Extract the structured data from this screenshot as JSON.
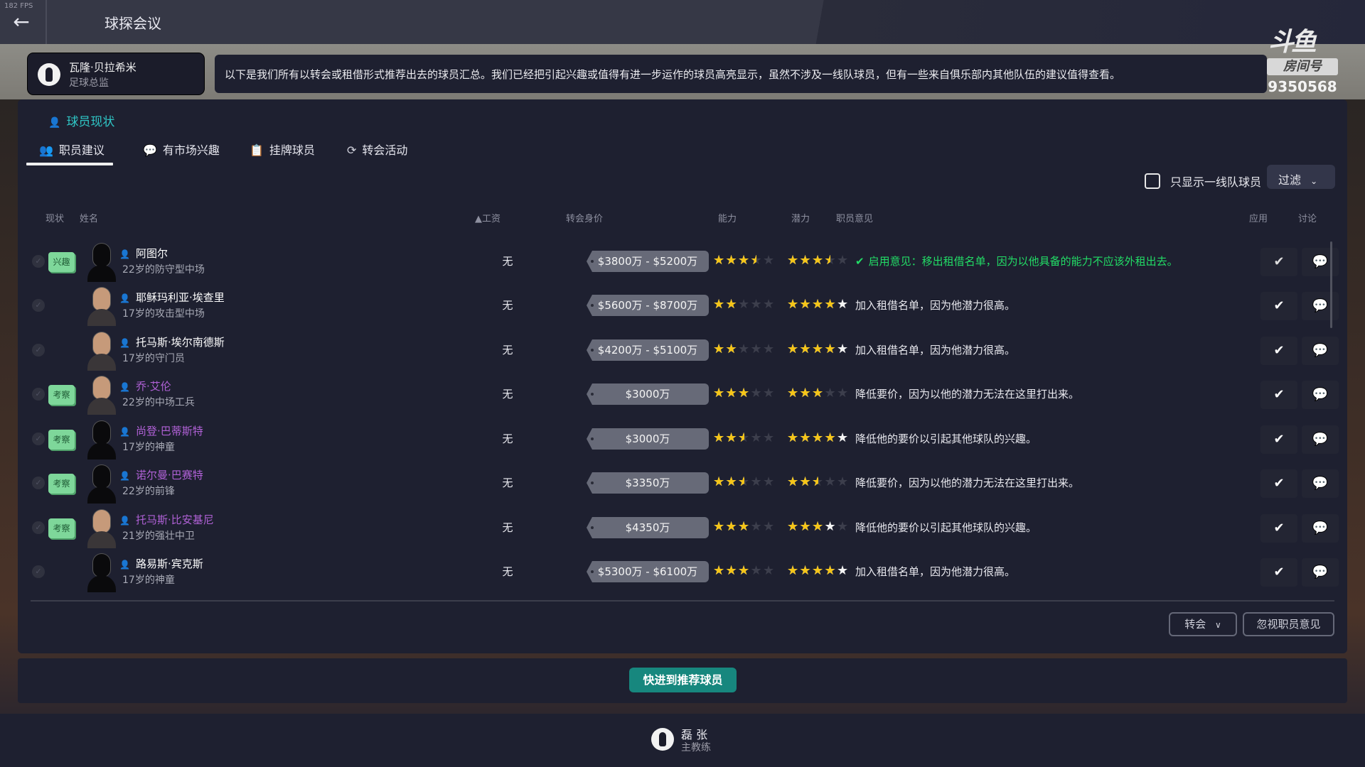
{
  "fps": "182 FPS",
  "header": {
    "title": "球探会议"
  },
  "director": {
    "name": "瓦隆·贝拉希米",
    "role": "足球总监",
    "message": "以下是我们所有以转会或租借形式推荐出去的球员汇总。我们已经把引起兴趣或值得有进一步运作的球员高亮显示，虽然不涉及一线队球员，但有一些来自俱乐部内其他队伍的建议值得查看。"
  },
  "watermark": {
    "logo": "斗鱼",
    "label": "房间号",
    "room": "9350568"
  },
  "section": {
    "title": "球员现状",
    "icon": "person-icon"
  },
  "tabs": [
    {
      "label": "职员建议",
      "icon": "staff-icon",
      "active": true
    },
    {
      "label": "有市场兴趣",
      "icon": "chat-icon",
      "active": false
    },
    {
      "label": "挂牌球员",
      "icon": "listing-icon",
      "active": false
    },
    {
      "label": "转会活动",
      "icon": "refresh-icon",
      "active": false
    }
  ],
  "filters": {
    "first_team_only_label": "只显示一线队球员",
    "first_team_only_checked": false,
    "filter_label": "过滤"
  },
  "columns": {
    "status": "现状",
    "name": "姓名",
    "wage": "▲工资",
    "value": "转会身价",
    "ability": "能力",
    "potential": "潜力",
    "opinion": "职员意见",
    "apply": "应用",
    "discuss": "讨论"
  },
  "colors": {
    "accent": "#2fc6c6",
    "highlight_name": "#b061d6",
    "star": "#f5c518",
    "applied": "#22dd66",
    "button": "#17877e"
  },
  "players": [
    {
      "badge": "兴趣",
      "name": "阿图尔",
      "name_color": "#ffffff",
      "desc": "22岁的防守型中场",
      "wage": "无",
      "value": "$3800万 - $5200万",
      "ability": 3.5,
      "potential": 3.5,
      "potential_max": 3.5,
      "opinion": "启用意见：移出租借名单，因为以他具备的能力不应该外租出去。",
      "applied": true,
      "face": "silhouette"
    },
    {
      "badge": "",
      "name": "耶稣玛利亚·埃查里",
      "name_color": "#ffffff",
      "desc": "17岁的攻击型中场",
      "wage": "无",
      "value": "$5600万 - $8700万",
      "ability": 2,
      "potential": 4,
      "potential_max": 5,
      "opinion": "加入租借名单，因为他潜力很高。",
      "applied": false,
      "face": "real"
    },
    {
      "badge": "",
      "name": "托马斯·埃尔南德斯",
      "name_color": "#ffffff",
      "desc": "17岁的守门员",
      "wage": "无",
      "value": "$4200万 - $5100万",
      "ability": 2,
      "potential": 4,
      "potential_max": 5,
      "opinion": "加入租借名单，因为他潜力很高。",
      "applied": false,
      "face": "real"
    },
    {
      "badge": "考察",
      "name": "乔·艾伦",
      "name_color": "#b061d6",
      "desc": "22岁的中场工兵",
      "wage": "无",
      "value": "$3000万",
      "ability": 3,
      "potential": 3,
      "potential_max": 3,
      "opinion": "降低要价，因为以他的潜力无法在这里打出来。",
      "applied": false,
      "face": "real"
    },
    {
      "badge": "考察",
      "name": "尚登·巴蒂斯特",
      "name_color": "#b061d6",
      "desc": "17岁的神童",
      "wage": "无",
      "value": "$3000万",
      "ability": 2.5,
      "potential": 4,
      "potential_max": 5,
      "opinion": "降低他的要价以引起其他球队的兴趣。",
      "applied": false,
      "face": "silhouette"
    },
    {
      "badge": "考察",
      "name": "诺尔曼·巴赛特",
      "name_color": "#b061d6",
      "desc": "22岁的前锋",
      "wage": "无",
      "value": "$3350万",
      "ability": 2.5,
      "potential": 2.5,
      "potential_max": 2.5,
      "opinion": "降低要价，因为以他的潜力无法在这里打出来。",
      "applied": false,
      "face": "silhouette"
    },
    {
      "badge": "考察",
      "name": "托马斯·比安基尼",
      "name_color": "#b061d6",
      "desc": "21岁的强壮中卫",
      "wage": "无",
      "value": "$4350万",
      "ability": 3,
      "potential": 3,
      "potential_max": 4,
      "opinion": "降低他的要价以引起其他球队的兴趣。",
      "applied": false,
      "face": "real"
    },
    {
      "badge": "",
      "name": "路易斯·宾克斯",
      "name_color": "#ffffff",
      "desc": "17岁的神童",
      "wage": "无",
      "value": "$5300万 - $6100万",
      "ability": 3,
      "potential": 4,
      "potential_max": 5,
      "opinion": "加入租借名单，因为他潜力很高。",
      "applied": false,
      "face": "silhouette"
    }
  ],
  "actions": {
    "transfer_label": "转会",
    "ignore_label": "忽视职员意见",
    "fast_forward_label": "快进到推荐球员"
  },
  "coach": {
    "name": "磊 张",
    "role": "主教练"
  }
}
